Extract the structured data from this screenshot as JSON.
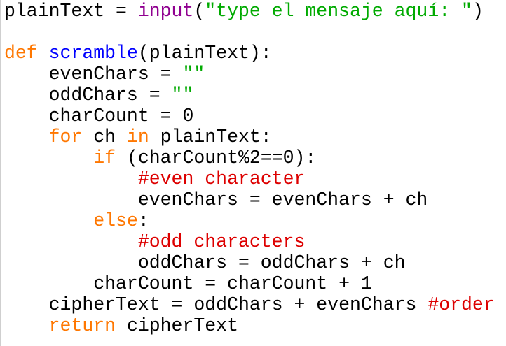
{
  "colors": {
    "keyword": "#ff7700",
    "builtin": "#900090",
    "definition": "#0000ff",
    "string": "#00aa00",
    "comment": "#dd0000",
    "text": "#000000",
    "background": "#ffffff"
  },
  "code": {
    "lines": [
      {
        "tokens": [
          {
            "t": "tx",
            "v": "plainText = "
          },
          {
            "t": "bi",
            "v": "input"
          },
          {
            "t": "tx",
            "v": "("
          },
          {
            "t": "st",
            "v": "\"type el mensaje aquí: \""
          },
          {
            "t": "tx",
            "v": ")"
          }
        ]
      },
      {
        "tokens": []
      },
      {
        "tokens": [
          {
            "t": "kw",
            "v": "def"
          },
          {
            "t": "tx",
            "v": " "
          },
          {
            "t": "fn",
            "v": "scramble"
          },
          {
            "t": "tx",
            "v": "(plainText):"
          }
        ]
      },
      {
        "tokens": [
          {
            "t": "tx",
            "v": "    evenChars = "
          },
          {
            "t": "st",
            "v": "\"\""
          }
        ]
      },
      {
        "tokens": [
          {
            "t": "tx",
            "v": "    oddChars = "
          },
          {
            "t": "st",
            "v": "\"\""
          }
        ]
      },
      {
        "tokens": [
          {
            "t": "tx",
            "v": "    charCount = 0"
          }
        ]
      },
      {
        "tokens": [
          {
            "t": "tx",
            "v": "    "
          },
          {
            "t": "kw",
            "v": "for"
          },
          {
            "t": "tx",
            "v": " ch "
          },
          {
            "t": "kw",
            "v": "in"
          },
          {
            "t": "tx",
            "v": " plainText:"
          }
        ]
      },
      {
        "tokens": [
          {
            "t": "tx",
            "v": "        "
          },
          {
            "t": "kw",
            "v": "if"
          },
          {
            "t": "tx",
            "v": " (charCount%2==0):"
          }
        ]
      },
      {
        "tokens": [
          {
            "t": "tx",
            "v": "            "
          },
          {
            "t": "cm",
            "v": "#even character"
          }
        ]
      },
      {
        "tokens": [
          {
            "t": "tx",
            "v": "            evenChars = evenChars + ch"
          }
        ]
      },
      {
        "tokens": [
          {
            "t": "tx",
            "v": "        "
          },
          {
            "t": "kw",
            "v": "else"
          },
          {
            "t": "tx",
            "v": ":"
          }
        ]
      },
      {
        "tokens": [
          {
            "t": "tx",
            "v": "            "
          },
          {
            "t": "cm",
            "v": "#odd characters"
          }
        ]
      },
      {
        "tokens": [
          {
            "t": "tx",
            "v": "            oddChars = oddChars + ch"
          }
        ]
      },
      {
        "tokens": [
          {
            "t": "tx",
            "v": "        charCount = charCount + 1"
          }
        ]
      },
      {
        "tokens": [
          {
            "t": "tx",
            "v": "    cipherText = oddChars + evenChars "
          },
          {
            "t": "cm",
            "v": "#order"
          }
        ]
      },
      {
        "tokens": [
          {
            "t": "tx",
            "v": "    "
          },
          {
            "t": "kw",
            "v": "return"
          },
          {
            "t": "tx",
            "v": " cipherText"
          }
        ]
      }
    ]
  }
}
